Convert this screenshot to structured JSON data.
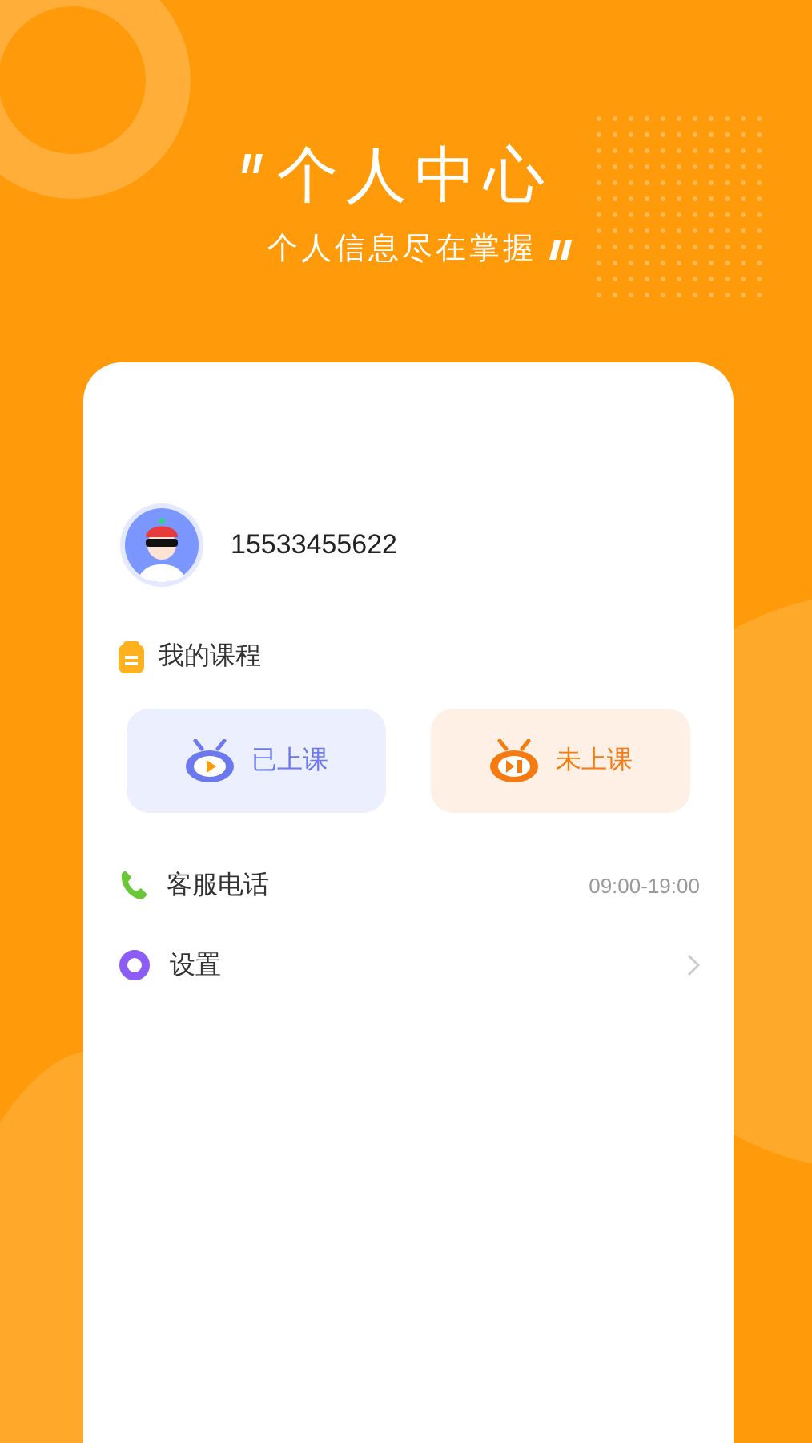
{
  "header": {
    "title": "个人中心",
    "subtitle": "个人信息尽在掌握"
  },
  "profile": {
    "phone": "15533455622"
  },
  "courses": {
    "label": "我的课程",
    "buttons": [
      {
        "label": "已上课",
        "kind": "attended"
      },
      {
        "label": "未上课",
        "kind": "pending"
      }
    ]
  },
  "menu": [
    {
      "label": "客服电话",
      "kind": "phone",
      "detail": "09:00-19:00"
    },
    {
      "label": "设置",
      "kind": "settings"
    }
  ]
}
